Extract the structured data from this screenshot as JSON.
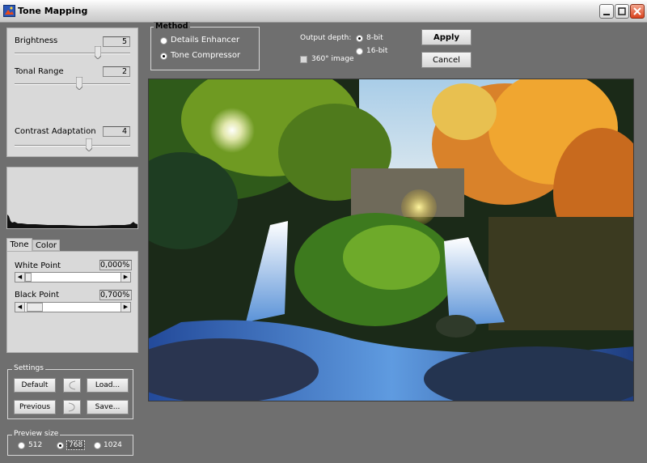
{
  "window": {
    "title": "Tone Mapping"
  },
  "sliders": {
    "brightness": {
      "label": "Brightness",
      "value": "5",
      "level": 0.72
    },
    "tonal_range": {
      "label": "Tonal Range",
      "value": "2",
      "level": 0.56
    },
    "contrast": {
      "label": "Contrast Adaptation",
      "value": "4",
      "level": 0.64
    }
  },
  "tabs": {
    "tone": "Tone",
    "color": "Color"
  },
  "points": {
    "white": {
      "label": "White Point",
      "value": "0,000%"
    },
    "black": {
      "label": "Black Point",
      "value": "0,700%"
    }
  },
  "settings": {
    "title": "Settings",
    "default": "Default",
    "load": "Load...",
    "previous": "Previous",
    "save": "Save..."
  },
  "preview_size": {
    "title": "Preview size",
    "options": [
      "512",
      "768",
      "1024"
    ],
    "selected": "768"
  },
  "method": {
    "title": "Method",
    "options": [
      "Details Enhancer",
      "Tone Compressor"
    ],
    "selected": "Tone Compressor"
  },
  "output": {
    "label": "Output depth:",
    "options": [
      "8-bit",
      "16-bit"
    ],
    "selected": "8-bit",
    "image360_label": "360° image"
  },
  "actions": {
    "apply": "Apply",
    "cancel": "Cancel"
  },
  "colors": {
    "background": "#6f6f6f",
    "panel": "#d9d9d9",
    "close_button": "#d9421d"
  }
}
